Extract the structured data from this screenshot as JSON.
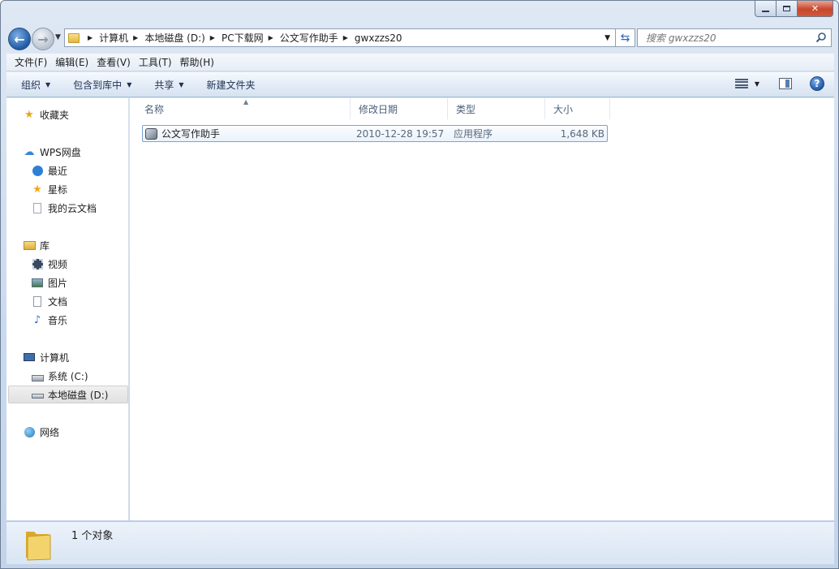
{
  "window": {
    "caption": {
      "minimize": "▭",
      "maximize": "□",
      "close": "✕"
    }
  },
  "address": {
    "crumbs": [
      "计算机",
      "本地磁盘 (D:)",
      "PC下载网",
      "公文写作助手",
      "gwxzzs20"
    ]
  },
  "search": {
    "placeholder": "搜索 gwxzzs20"
  },
  "menubar": {
    "items": [
      "文件(F)",
      "编辑(E)",
      "查看(V)",
      "工具(T)",
      "帮助(H)"
    ]
  },
  "cmdbar": {
    "organize": "组织",
    "include_in_library": "包含到库中",
    "share": "共享",
    "new_folder": "新建文件夹"
  },
  "nav_pane": {
    "favorites": "收藏夹",
    "wps": "WPS网盘",
    "wps_items": [
      "最近",
      "星标",
      "我的云文档"
    ],
    "library": "库",
    "library_items": [
      "视频",
      "图片",
      "文档",
      "音乐"
    ],
    "computer": "计算机",
    "computer_items": [
      "系统 (C:)",
      "本地磁盘 (D:)"
    ],
    "network": "网络"
  },
  "columns": {
    "name": "名称",
    "modified": "修改日期",
    "type": "类型",
    "size": "大小"
  },
  "files": [
    {
      "name": "公文写作助手",
      "modified": "2010-12-28 19:57",
      "type": "应用程序",
      "size": "1,648 KB"
    }
  ],
  "status": {
    "count": "1 个对象"
  },
  "colors": {
    "selection_border": "#7da2ce",
    "chrome": "#c9d9ee",
    "accent": "#1f5aa3"
  }
}
